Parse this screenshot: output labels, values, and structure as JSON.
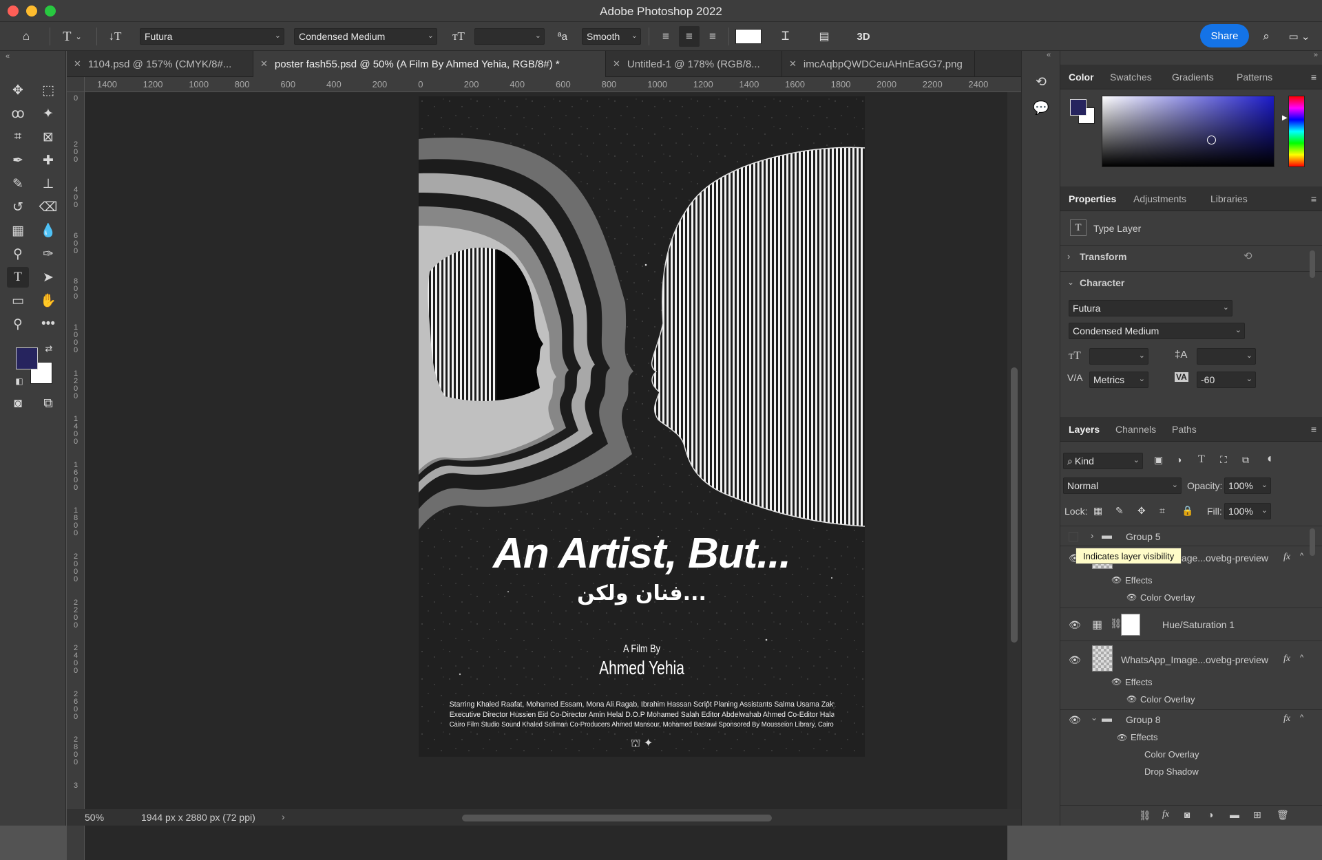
{
  "window": {
    "title": "Adobe Photoshop 2022"
  },
  "options_bar": {
    "font_family": "Futura",
    "font_style": "Condensed Medium",
    "font_size": "",
    "antialias": "Smooth",
    "mode_3d": "3D",
    "share": "Share"
  },
  "tabs": [
    {
      "label": "1104.psd @ 157% (CMYK/8#..."
    },
    {
      "label": "poster fash55.psd @ 50% (A Film By Ahmed Yehia, RGB/8#) *"
    },
    {
      "label": "Untitled-1 @ 178% (RGB/8..."
    },
    {
      "label": "imcAqbpQWDCeuAHnEaGG7.png"
    }
  ],
  "ruler_h": [
    "1400",
    "1200",
    "1000",
    "800",
    "600",
    "400",
    "200",
    "0",
    "200",
    "400",
    "600",
    "800",
    "1000",
    "1200",
    "1400",
    "1600",
    "1800",
    "2000",
    "2200",
    "2400"
  ],
  "ruler_v": [
    "0",
    "200",
    "400",
    "600",
    "800",
    "1000",
    "1200",
    "1400",
    "1600",
    "1800",
    "2000",
    "2200",
    "2400",
    "2600",
    "2800",
    "3"
  ],
  "status": {
    "zoom": "50%",
    "doc_info": "1944 px x 2880 px (72 ppi)"
  },
  "poster": {
    "title": "An Artist, But...",
    "arabic_title": "فنان ولكن...",
    "film_by": "A Film By",
    "director": "Ahmed Yehia",
    "credits_line1": "Starring Khaled Raafat, Mohamed Essam, Mona Ali Ragab, Ibrahim Hassan Script Planing Assistants Salma Usama Zaky, Ahmed Essam, Ahmed Khalil",
    "credits_line2": "Executive Director Hussien Eid Co-Director Amin Helal D.O.P Mohamed Salah Editor Abdelwahab Ahmed Co-Editor Hala Zahra Music Composer Ziad Hassan Lighting",
    "credits_line3": "Cairo Film Studio Sound Khaled Soliman Co-Producers Ahmed Mansour, Mohamed Bastawi Sponsored By Mousseion Library, Cairo Film Studio"
  },
  "color_panel": {
    "tabs": [
      "Color",
      "Swatches",
      "Gradients",
      "Patterns"
    ],
    "foreground": "#26245e",
    "background": "#ffffff"
  },
  "properties": {
    "tabs": [
      "Properties",
      "Adjustments",
      "Libraries"
    ],
    "layer_type": "Type Layer",
    "transform": "Transform",
    "character": "Character",
    "font": "Futura",
    "style": "Condensed Medium",
    "size": "",
    "leading": "",
    "kerning": "Metrics",
    "tracking": "-60"
  },
  "layers_panel": {
    "tabs": [
      "Layers",
      "Channels",
      "Paths"
    ],
    "filter": "Kind",
    "blend_mode": "Normal",
    "opacity_label": "Opacity:",
    "opacity": "100%",
    "lock_label": "Lock:",
    "fill_label": "Fill:",
    "fill": "100%",
    "tooltip": "Indicates layer visibility",
    "layers": [
      {
        "name": "Group 5"
      },
      {
        "name": "WhatsApp_Image...ovebg-preview",
        "effects": "Effects",
        "effect1": "Color Overlay"
      },
      {
        "name": "Hue/Saturation 1"
      },
      {
        "name": "WhatsApp_Image...ovebg-preview",
        "effects": "Effects",
        "effect1": "Color Overlay"
      },
      {
        "name": "Group 8",
        "effects": "Effects",
        "effect1": "Color Overlay",
        "effect2": "Drop Shadow"
      }
    ]
  }
}
